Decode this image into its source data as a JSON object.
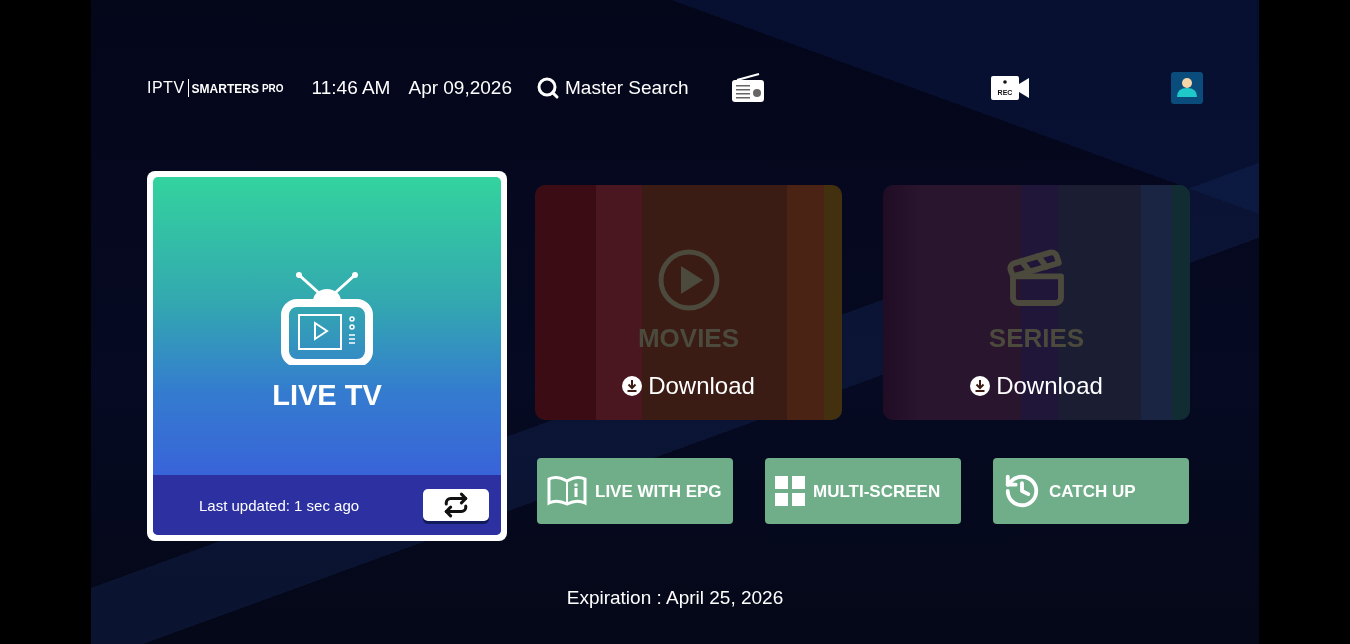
{
  "header": {
    "logo": {
      "prefix": "IPTV",
      "name": "SMARTERS",
      "suffix": "PRO"
    },
    "time": "11:46 AM",
    "date": "Apr 09,2026",
    "search": "Master Search",
    "rec_label": "REC"
  },
  "tiles": [
    {
      "kind": "live",
      "title": "LIVE TV",
      "selected": true,
      "status": "Last updated: 1 sec ago"
    },
    {
      "kind": "movies",
      "title": "MOVIES",
      "action": "Download",
      "selected": false
    },
    {
      "kind": "series",
      "title": "SERIES",
      "action": "Download",
      "selected": false
    }
  ],
  "buttons": [
    {
      "kind": "epg",
      "label": "LIVE WITH EPG"
    },
    {
      "kind": "multi",
      "label": "MULTI-SCREEN"
    },
    {
      "kind": "catchup",
      "label": "CATCH UP"
    }
  ],
  "expiration": "Expiration : April 25, 2026"
}
